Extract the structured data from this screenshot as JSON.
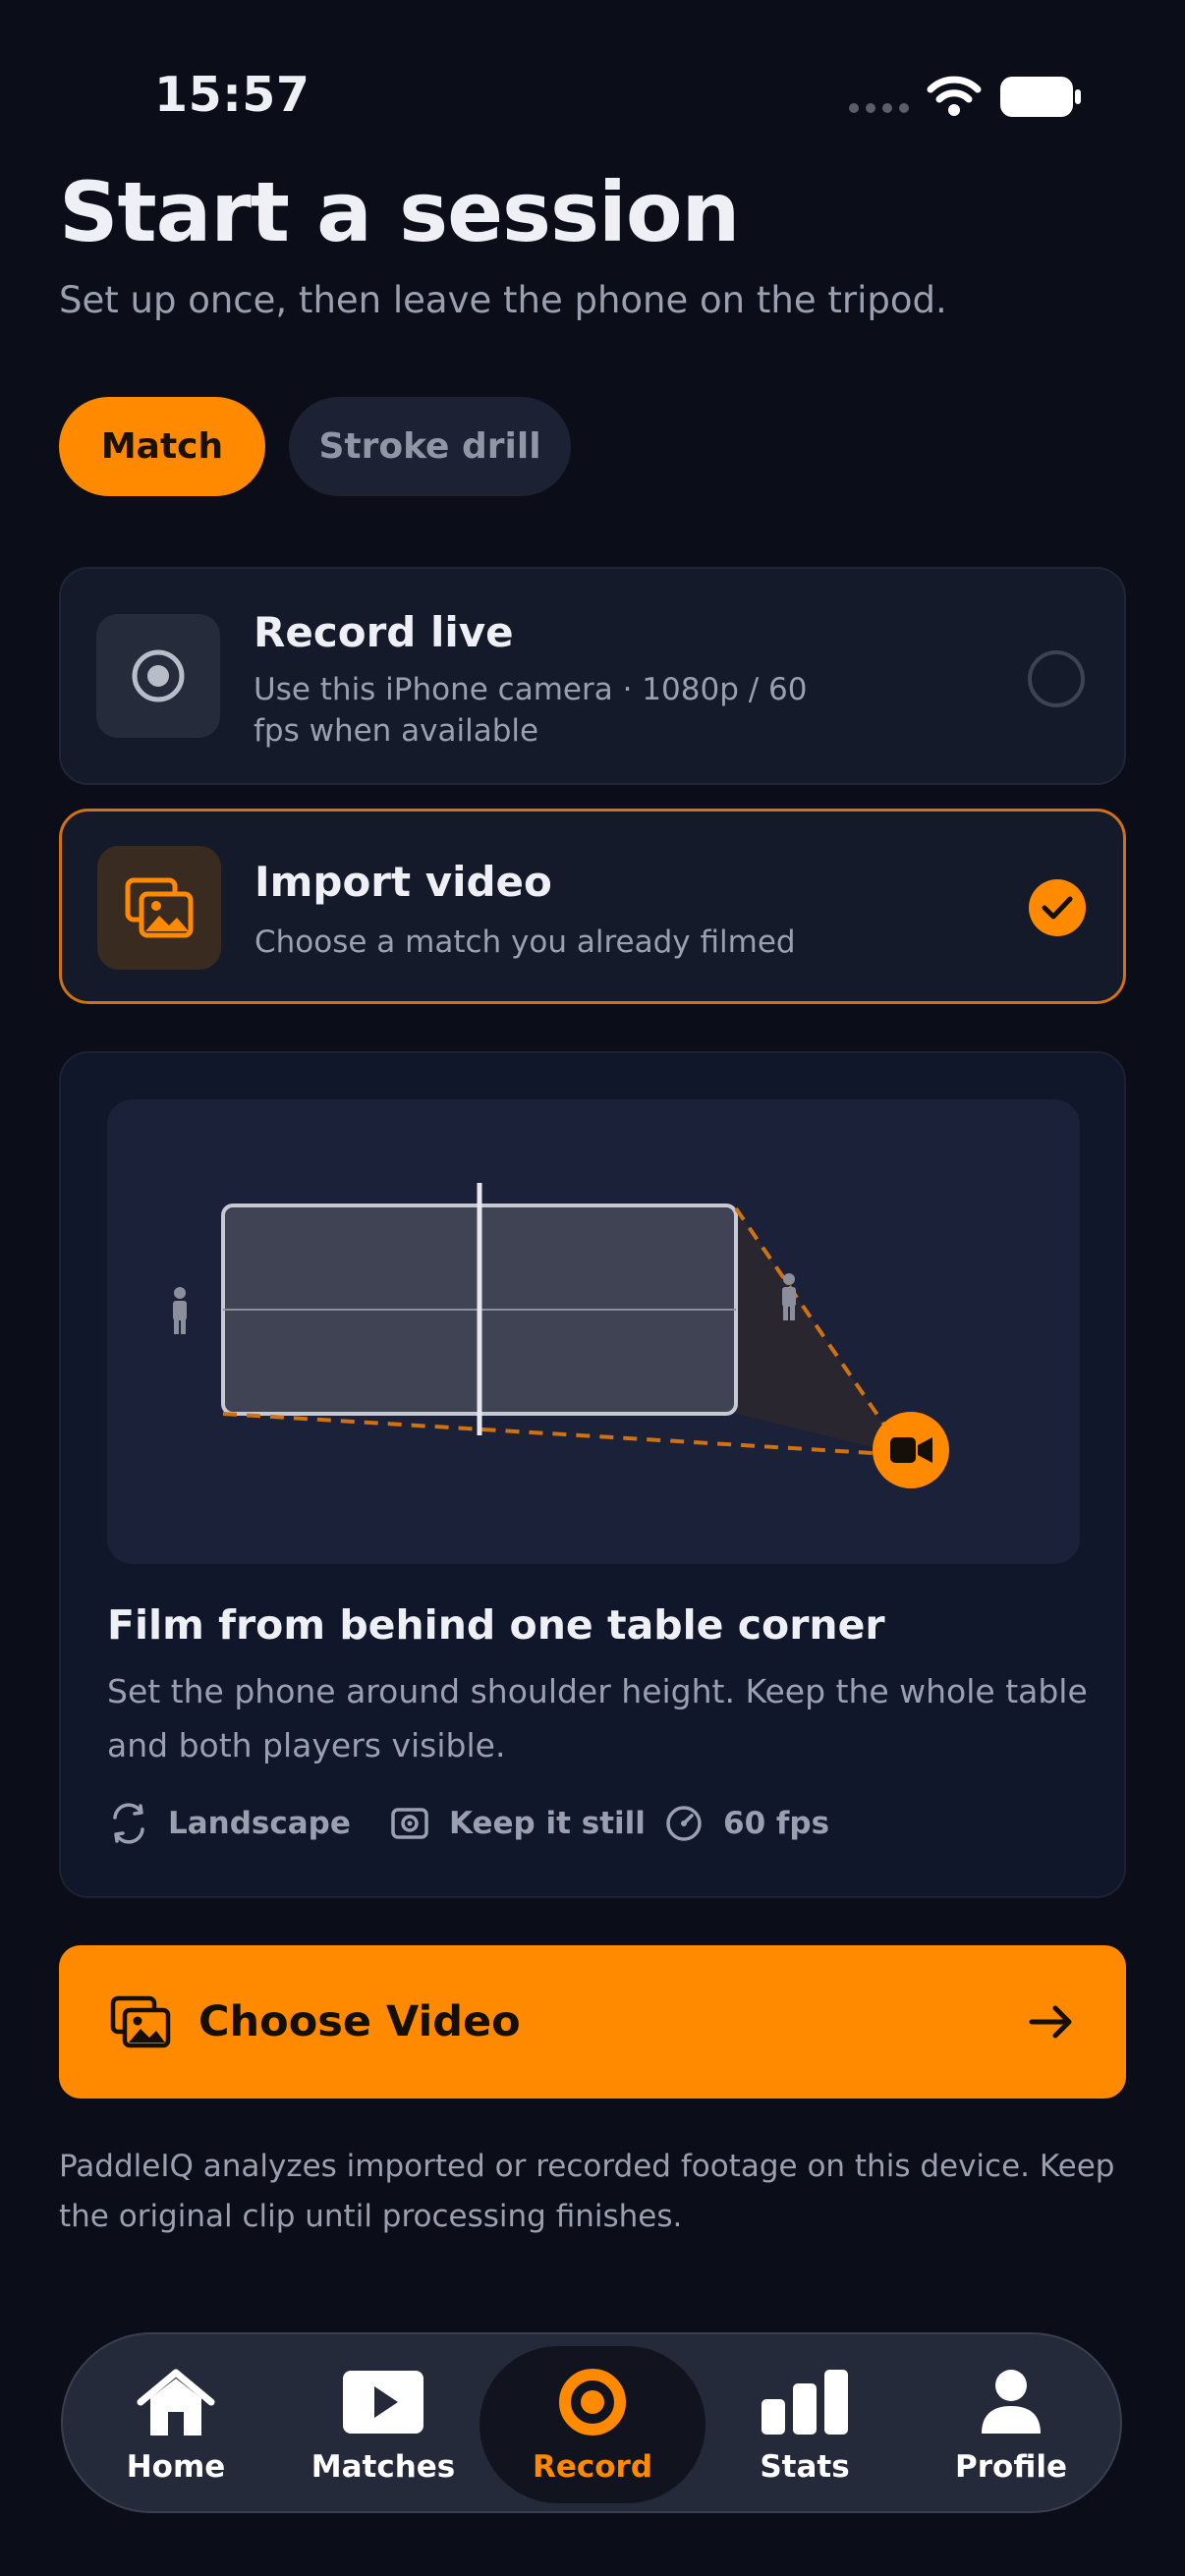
{
  "status_bar": {
    "time": "15:57"
  },
  "header": {
    "title": "Start a session",
    "subtitle": "Set up once, then leave the phone on the tripod."
  },
  "segments": {
    "match": "Match",
    "stroke_drill": "Stroke drill",
    "selected": "Match"
  },
  "options": {
    "record_live": {
      "title": "Record live",
      "description": "Use this iPhone camera · 1080p / 60 fps when available",
      "selected": false
    },
    "import_video": {
      "title": "Import video",
      "description": "Choose a match you already filmed",
      "selected": true
    }
  },
  "tips": {
    "title": "Film from behind one table corner",
    "description": "Set the phone around shoulder height. Keep the whole table and both players visible.",
    "chips": [
      {
        "icon": "rotate-icon",
        "label": "Landscape"
      },
      {
        "icon": "stabilize-icon",
        "label": "Keep it still"
      },
      {
        "icon": "speed-gauge-icon",
        "label": "60 fps"
      }
    ]
  },
  "cta": {
    "label": "Choose Video"
  },
  "footnote": "PaddleIQ analyzes imported or recorded footage on this device. Keep the original clip until processing finishes.",
  "tab_bar": {
    "items": [
      {
        "label": "Home",
        "icon": "home-icon"
      },
      {
        "label": "Matches",
        "icon": "play-icon"
      },
      {
        "label": "Record",
        "icon": "record-icon",
        "active": true
      },
      {
        "label": "Stats",
        "icon": "bar-chart-icon"
      },
      {
        "label": "Profile",
        "icon": "person-icon"
      }
    ]
  },
  "colors": {
    "accent": "#ff8a00",
    "background": "#0b0d18",
    "card": "#141a29",
    "muted_text": "#9aa0b0"
  }
}
